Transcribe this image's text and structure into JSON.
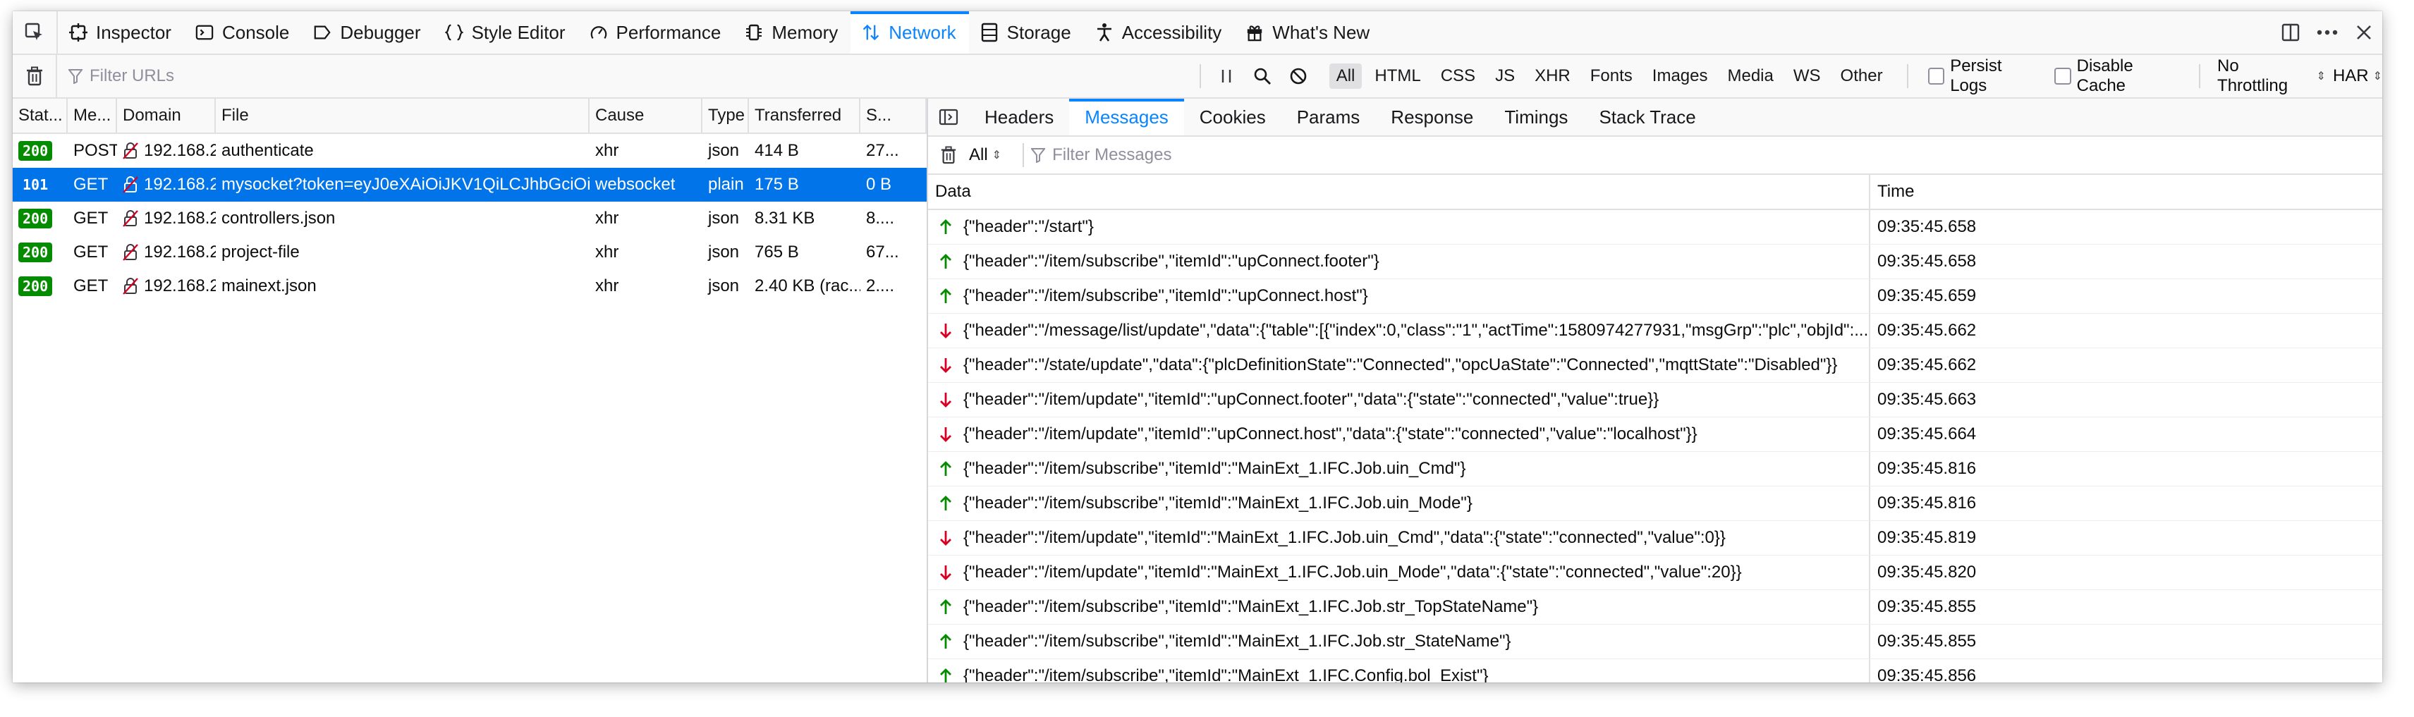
{
  "toolbox": {
    "tabs": [
      {
        "label": "Inspector",
        "icon": "inspector-icon"
      },
      {
        "label": "Console",
        "icon": "console-icon"
      },
      {
        "label": "Debugger",
        "icon": "debugger-icon"
      },
      {
        "label": "Style Editor",
        "icon": "braces-icon"
      },
      {
        "label": "Performance",
        "icon": "gauge-icon"
      },
      {
        "label": "Memory",
        "icon": "chip-icon"
      },
      {
        "label": "Network",
        "icon": "network-arrows-icon",
        "selected": true
      },
      {
        "label": "Storage",
        "icon": "storage-icon"
      },
      {
        "label": "Accessibility",
        "icon": "accessibility-icon"
      },
      {
        "label": "What's New",
        "icon": "gift-icon"
      }
    ]
  },
  "net_toolbar": {
    "filter_placeholder": "Filter URLs",
    "types": [
      "All",
      "HTML",
      "CSS",
      "JS",
      "XHR",
      "Fonts",
      "Images",
      "Media",
      "WS",
      "Other"
    ],
    "selected_type": "All",
    "persist_logs": "Persist Logs",
    "disable_cache": "Disable Cache",
    "throttling": "No Throttling",
    "har": "HAR"
  },
  "requests": {
    "columns": [
      "Stat...",
      "Me...",
      "Domain",
      "File",
      "Cause",
      "Type",
      "Transferred",
      "S..."
    ],
    "rows": [
      {
        "status": "200",
        "method": "POST",
        "domain": "192.168.2...",
        "file": "authenticate",
        "cause": "xhr",
        "type": "json",
        "transferred": "414 B",
        "size": "27..."
      },
      {
        "status": "101",
        "method": "GET",
        "domain": "192.168.2...",
        "file": "mysocket?token=eyJ0eXAiOiJKV1QiLCJhbGciOi...",
        "cause": "websocket",
        "type": "plain",
        "transferred": "175 B",
        "size": "0 B",
        "selected": true
      },
      {
        "status": "200",
        "method": "GET",
        "domain": "192.168.2...",
        "file": "controllers.json",
        "cause": "xhr",
        "type": "json",
        "transferred": "8.31 KB",
        "size": "8...."
      },
      {
        "status": "200",
        "method": "GET",
        "domain": "192.168.2...",
        "file": "project-file",
        "cause": "xhr",
        "type": "json",
        "transferred": "765 B",
        "size": "67..."
      },
      {
        "status": "200",
        "method": "GET",
        "domain": "192.168.2...",
        "file": "mainext.json",
        "cause": "xhr",
        "type": "json",
        "transferred": "2.40 KB (rac...",
        "size": "2...."
      }
    ]
  },
  "sidepanel": {
    "tabs": [
      "Headers",
      "Messages",
      "Cookies",
      "Params",
      "Response",
      "Timings",
      "Stack Trace"
    ],
    "selected_tab": "Messages",
    "messages_filter": {
      "all": "All",
      "placeholder": "Filter Messages"
    },
    "columns": [
      "Data",
      "Time"
    ],
    "messages": [
      {
        "dir": "sent",
        "data": "{\"header\":\"/start\"}",
        "time": "09:35:45.658"
      },
      {
        "dir": "sent",
        "data": "{\"header\":\"/item/subscribe\",\"itemId\":\"upConnect.footer\"}",
        "time": "09:35:45.658"
      },
      {
        "dir": "sent",
        "data": "{\"header\":\"/item/subscribe\",\"itemId\":\"upConnect.host\"}",
        "time": "09:35:45.659"
      },
      {
        "dir": "received",
        "data": "{\"header\":\"/message/list/update\",\"data\":{\"table\":[{\"index\":0,\"class\":\"1\",\"actTime\":1580974277931,\"msgGrp\":\"plc\",\"objId\":...",
        "time": "09:35:45.662"
      },
      {
        "dir": "received",
        "data": "{\"header\":\"/state/update\",\"data\":{\"plcDefinitionState\":\"Connected\",\"opcUaState\":\"Connected\",\"mqttState\":\"Disabled\"}}",
        "time": "09:35:45.662"
      },
      {
        "dir": "received",
        "data": "{\"header\":\"/item/update\",\"itemId\":\"upConnect.footer\",\"data\":{\"state\":\"connected\",\"value\":true}}",
        "time": "09:35:45.663"
      },
      {
        "dir": "received",
        "data": "{\"header\":\"/item/update\",\"itemId\":\"upConnect.host\",\"data\":{\"state\":\"connected\",\"value\":\"localhost\"}}",
        "time": "09:35:45.664"
      },
      {
        "dir": "sent",
        "data": "{\"header\":\"/item/subscribe\",\"itemId\":\"MainExt_1.IFC.Job.uin_Cmd\"}",
        "time": "09:35:45.816"
      },
      {
        "dir": "sent",
        "data": "{\"header\":\"/item/subscribe\",\"itemId\":\"MainExt_1.IFC.Job.uin_Mode\"}",
        "time": "09:35:45.816"
      },
      {
        "dir": "received",
        "data": "{\"header\":\"/item/update\",\"itemId\":\"MainExt_1.IFC.Job.uin_Cmd\",\"data\":{\"state\":\"connected\",\"value\":0}}",
        "time": "09:35:45.819"
      },
      {
        "dir": "received",
        "data": "{\"header\":\"/item/update\",\"itemId\":\"MainExt_1.IFC.Job.uin_Mode\",\"data\":{\"state\":\"connected\",\"value\":20}}",
        "time": "09:35:45.820"
      },
      {
        "dir": "sent",
        "data": "{\"header\":\"/item/subscribe\",\"itemId\":\"MainExt_1.IFC.Job.str_TopStateName\"}",
        "time": "09:35:45.855"
      },
      {
        "dir": "sent",
        "data": "{\"header\":\"/item/subscribe\",\"itemId\":\"MainExt_1.IFC.Job.str_StateName\"}",
        "time": "09:35:45.855"
      },
      {
        "dir": "sent",
        "data": "{\"header\":\"/item/subscribe\",\"itemId\":\"MainExt_1.IFC.Config.bol_Exist\"}",
        "time": "09:35:45.856"
      }
    ]
  },
  "colors": {
    "accent": "#0a84ff",
    "selected_row": "#0074e8",
    "status_ok": "#058b00",
    "sent_arrow": "#058b00",
    "received_arrow": "#d70022"
  }
}
